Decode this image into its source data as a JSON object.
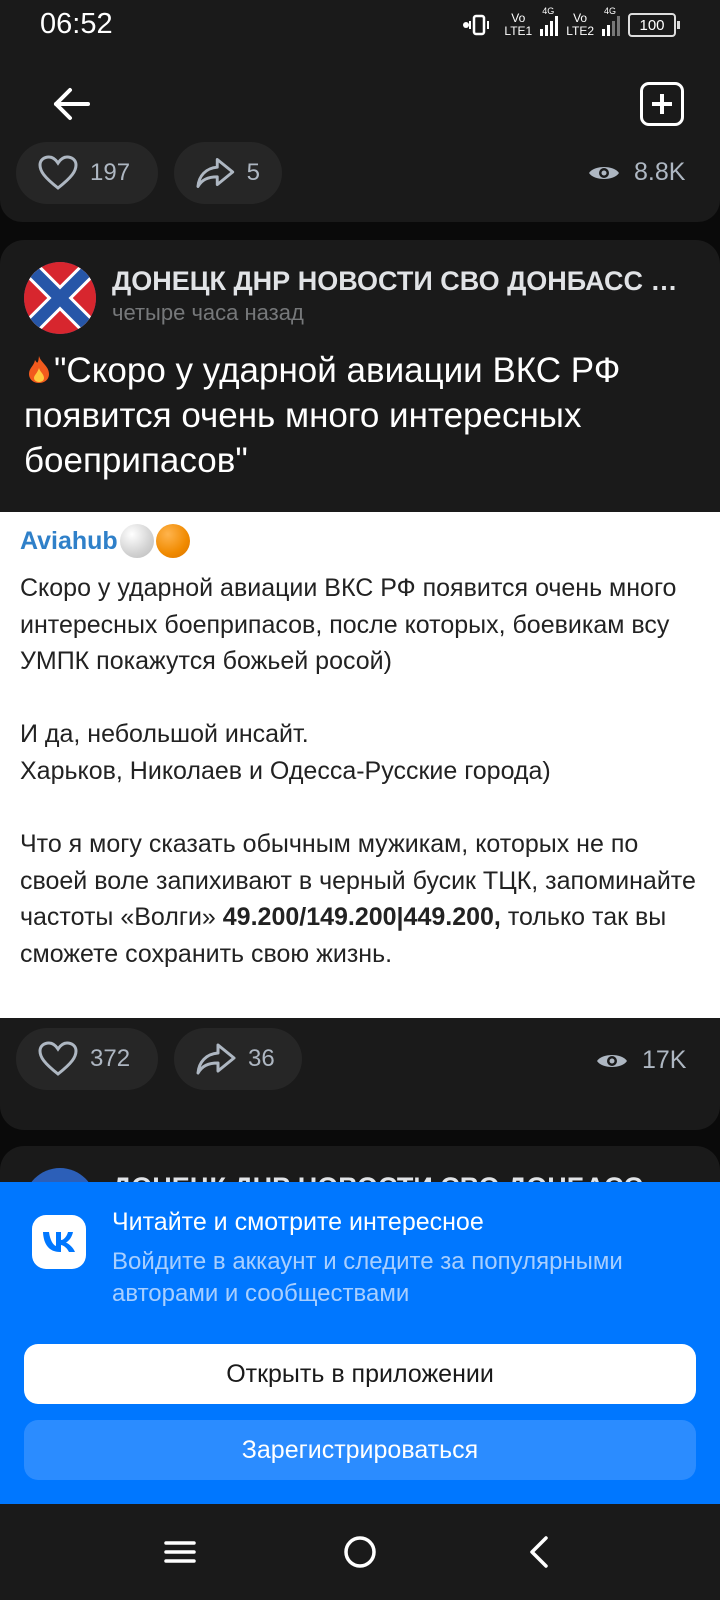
{
  "status_bar": {
    "time": "06:52",
    "sim1": {
      "top": "Vo",
      "bottom": "LTE1",
      "type": "4G"
    },
    "sim2": {
      "top": "Vo",
      "bottom": "LTE2",
      "type": "4G"
    },
    "battery": "100"
  },
  "top_bar": {
    "back_icon": "arrow-left-icon",
    "add_icon": "plus-square-icon"
  },
  "previous_post": {
    "likes": "197",
    "shares": "5",
    "views": "8.8K"
  },
  "post": {
    "source_name": "ДОНЕЦК ДНР НОВОСТИ СВО ДОНБАСС ЛУГАНСК",
    "time": "четыре часа назад",
    "title": "\"Скоро у ударной авиации ВКС РФ появится очень много интересных боеприпасов\"",
    "repost": {
      "author": "Aviahub",
      "p1": "Скоро у ударной авиации ВКС РФ появится очень много интересных боеприпасов, после которых, боевикам всу УМПК покажутся божьей росой)",
      "p2a": "И да, небольшой инсайт.",
      "p2b": "Харьков, Николаев и Одесса-Русские города)",
      "p3": "Что я могу сказать обычным мужикам, которых не по своей воле запихивают в черный бусик ТЦК, запоминайте частоты «Волги»",
      "freq": "49.200/149.200|449.200,",
      "p3_end": " только так вы сможете сохранить свою жизнь."
    },
    "likes": "372",
    "shares": "36",
    "views": "17K"
  },
  "next_post": {
    "source_name": "ДОНЕЦК ДНР НОВОСТИ СВО ДОНБАСС"
  },
  "login_sheet": {
    "title": "Читайте и смотрите интересное",
    "subtitle": "Войдите в аккаунт и следите за популярными авторами и сообществами",
    "open_button": "Открыть в приложении",
    "register_button": "Зарегистрироваться"
  },
  "nav_bar": {
    "menu_icon": "menu-icon",
    "home_icon": "home-circle-icon",
    "back_icon": "back-chevron-icon"
  },
  "colors": {
    "accent": "#0077ff",
    "card_bg": "#1a1a1a",
    "link": "#2f80c9"
  }
}
